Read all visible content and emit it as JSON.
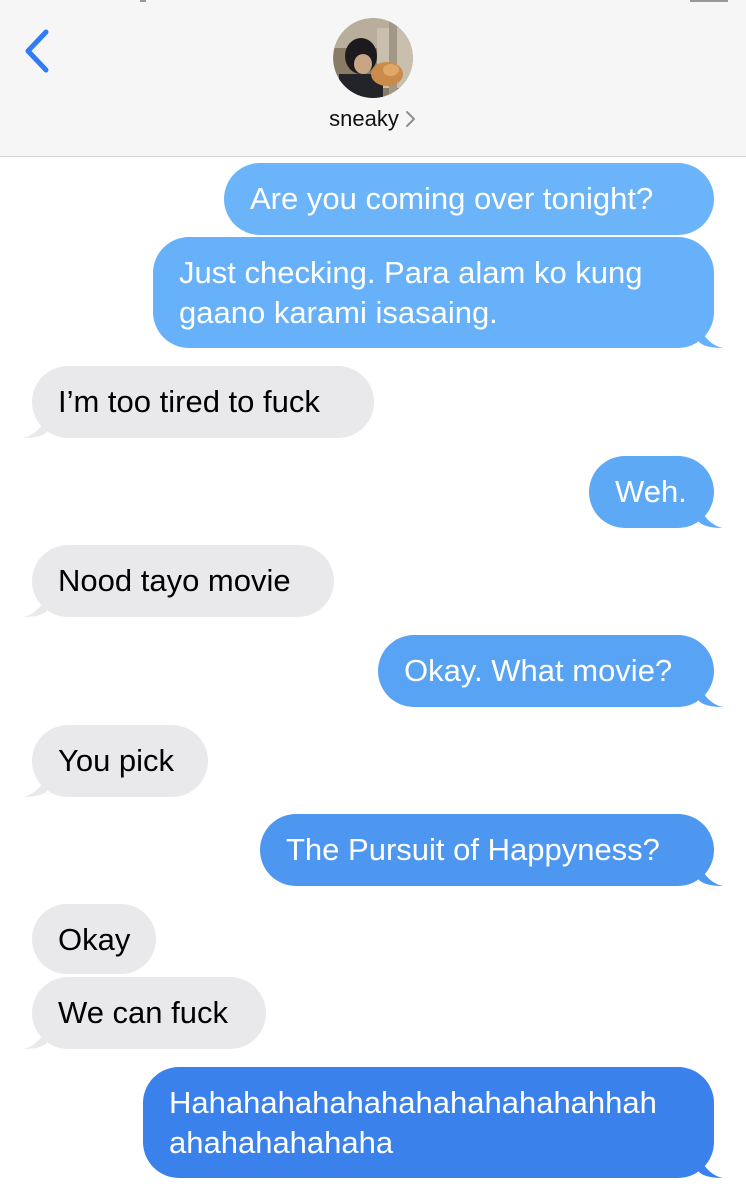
{
  "header": {
    "contact_name": "sneaky"
  },
  "messages": [
    {
      "from": "me",
      "lines": [
        "Are you coming over tonight?"
      ],
      "color": "#6cb4fa"
    },
    {
      "from": "me",
      "lines": [
        "Just checking. Para alam ko kung",
        "gaano karami isasaing."
      ],
      "color": "#66b1f9"
    },
    {
      "from": "them",
      "lines": [
        "I’m too tired to fuck"
      ]
    },
    {
      "from": "me",
      "lines": [
        "Weh."
      ],
      "color": "#5ea9f6"
    },
    {
      "from": "them",
      "lines": [
        "Nood tayo movie"
      ]
    },
    {
      "from": "me",
      "lines": [
        "Okay. What movie?"
      ],
      "color": "#58a3f4"
    },
    {
      "from": "them",
      "lines": [
        "You pick"
      ]
    },
    {
      "from": "me",
      "lines": [
        "The Pursuit of Happyness?"
      ],
      "color": "#4d97f1"
    },
    {
      "from": "them",
      "lines": [
        "Okay"
      ]
    },
    {
      "from": "them",
      "lines": [
        "We can fuck"
      ]
    },
    {
      "from": "me",
      "lines": [
        "Hahahahahahahahahahahahahhah",
        "ahahahahahaha"
      ],
      "color": "#3a81ec"
    }
  ],
  "colors": {
    "back_chevron": "#2f7cf6",
    "received_bubble": "#e9e9eb",
    "header_bg": "#f6f6f6"
  }
}
